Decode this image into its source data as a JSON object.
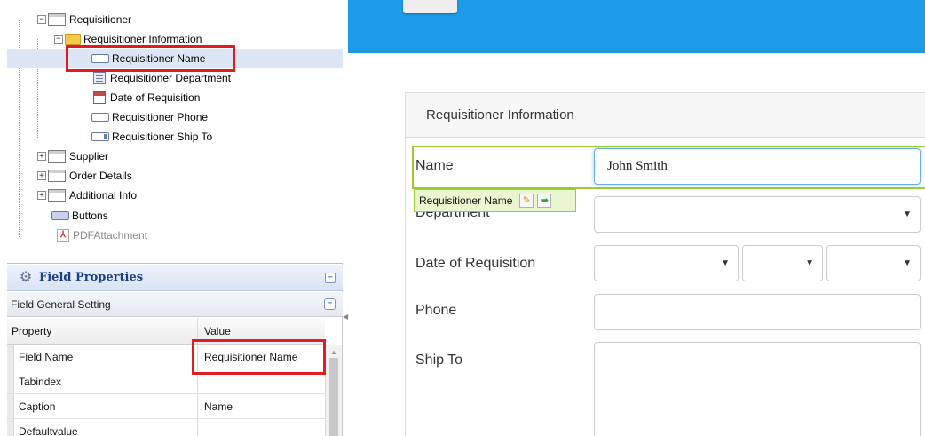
{
  "tree": {
    "items": [
      {
        "label": "Requisitioner",
        "expander": "−"
      },
      {
        "label": "Requisitioner Information",
        "expander": "−"
      },
      {
        "label": "Requisitioner Name"
      },
      {
        "label": "Requisitioner Department"
      },
      {
        "label": "Date of Requisition"
      },
      {
        "label": "Requisitioner Phone"
      },
      {
        "label": "Requisitioner Ship To"
      },
      {
        "label": "Supplier",
        "expander": "+"
      },
      {
        "label": "Order Details",
        "expander": "+"
      },
      {
        "label": "Additional Info",
        "expander": "+"
      },
      {
        "label": "Buttons"
      },
      {
        "label": "PDFAttachment"
      }
    ],
    "pdf_glyph": "⅄"
  },
  "field_properties": {
    "title": "Field Properties",
    "collapse_glyph": "−",
    "group_title": "Field General Setting",
    "group_collapse_glyph": "−",
    "columns": [
      "Property",
      "Value"
    ],
    "rows": [
      {
        "property": "Field Name",
        "value": "Requisitioner Name"
      },
      {
        "property": "Tabindex",
        "value": ""
      },
      {
        "property": "Caption",
        "value": "Name"
      },
      {
        "property": "Defaultvalue",
        "value": ""
      }
    ]
  },
  "form": {
    "section_title": "Requisitioner Information",
    "labels": {
      "name": "Name",
      "department": "Department",
      "date": "Date of Requisition",
      "phone": "Phone",
      "ship_to": "Ship To"
    },
    "name_value": "John Smith",
    "select_arrow": "▼",
    "field_tag": {
      "label": "Requisitioner Name",
      "edit_glyph": "✎",
      "next_glyph": "➡"
    }
  },
  "colors": {
    "top_bar": "#1e9be8",
    "highlight_box": "#e11b22",
    "field_frame": "#9acd32",
    "panel_title": "#1c3f86"
  },
  "icons": [
    "expand-icon",
    "collapse-icon",
    "folder-icon",
    "field-icon",
    "calendar-icon",
    "button-icon",
    "pdf-icon",
    "gear-icon",
    "edit-icon",
    "arrow-right-icon"
  ]
}
